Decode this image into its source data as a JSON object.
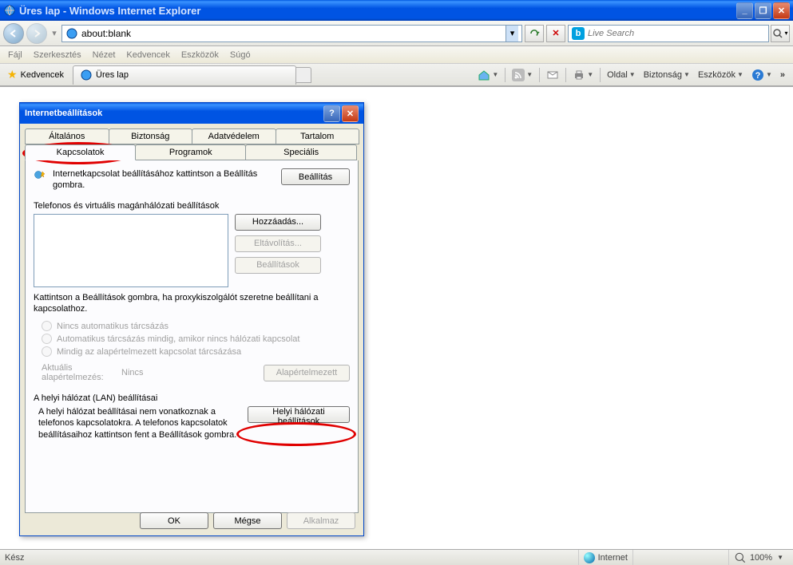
{
  "window": {
    "title": "Üres lap - Windows Internet Explorer"
  },
  "navbar": {
    "url": "about:blank",
    "search_placeholder": "Live Search"
  },
  "menus": [
    "Fájl",
    "Szerkesztés",
    "Nézet",
    "Kedvencek",
    "Eszközök",
    "Súgó"
  ],
  "fav_label": "Kedvencek",
  "tab_title": "Üres lap",
  "cmdbar": {
    "page": "Oldal",
    "safety": "Biztonság",
    "tools": "Eszközök"
  },
  "dialog": {
    "title": "Internetbeállítások",
    "tabs_row1": [
      "Általános",
      "Biztonság",
      "Adatvédelem",
      "Tartalom"
    ],
    "tabs_row2": [
      "Kapcsolatok",
      "Programok",
      "Speciális"
    ],
    "setup_text": "Internetkapcsolat beállításához kattintson a Beállítás gombra.",
    "setup_btn": "Beállítás",
    "dialup_label": "Telefonos és virtuális magánhálózati beállítások",
    "add_btn": "Hozzáadás...",
    "remove_btn": "Eltávolítás...",
    "settings_btn": "Beállítások",
    "proxy_hint": "Kattintson a Beállítások gombra, ha proxykiszolgálót szeretne beállítani a kapcsolathoz.",
    "radio1": "Nincs automatikus tárcsázás",
    "radio2": "Automatikus tárcsázás mindig, amikor nincs hálózati kapcsolat",
    "radio3": "Mindig az alapértelmezett kapcsolat tárcsázása",
    "default_lbl": "Aktuális alapértelmezés:",
    "default_val": "Nincs",
    "default_btn": "Alapértelmezett",
    "lan_label": "A helyi hálózat (LAN) beállításai",
    "lan_text": "A helyi hálózat beállításai nem vonatkoznak a telefonos kapcsolatokra. A telefonos kapcsolatok beállításaihoz kattintson fent a Beállítások gombra.",
    "lan_btn": "Helyi hálózati beállítások",
    "ok": "OK",
    "cancel": "Mégse",
    "apply": "Alkalmaz"
  },
  "status": {
    "ready": "Kész",
    "zone": "Internet",
    "zoom": "100%"
  }
}
